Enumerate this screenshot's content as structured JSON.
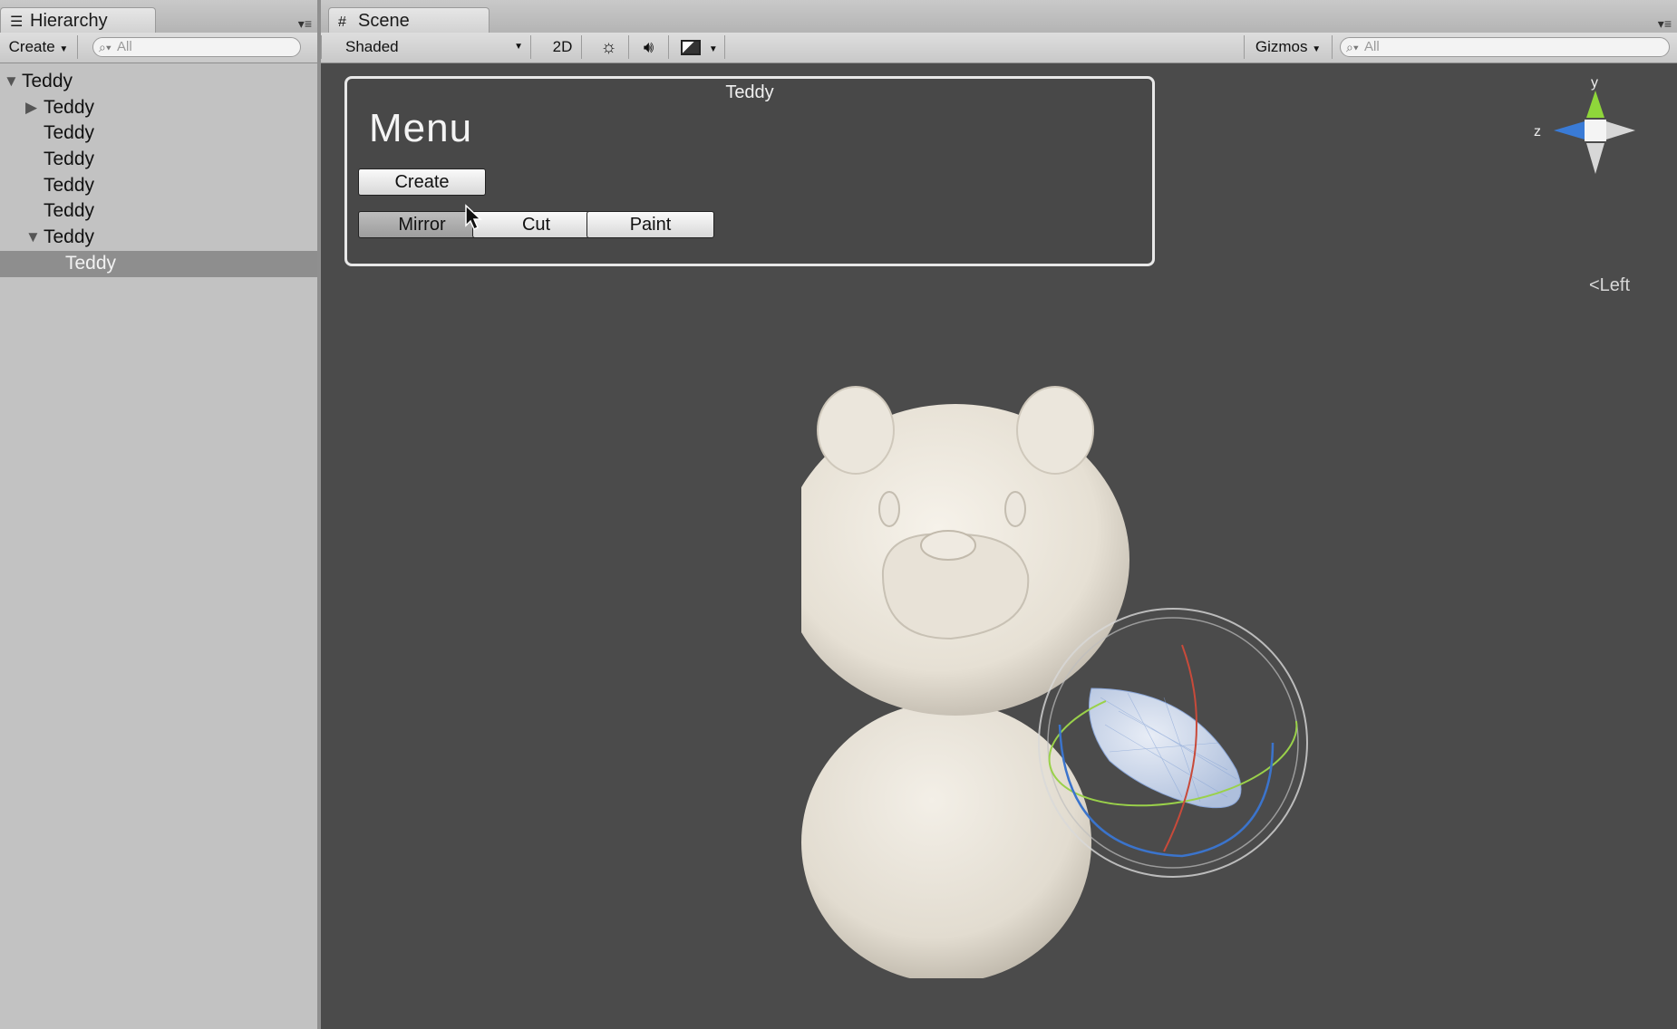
{
  "hierarchy": {
    "tab_label": "Hierarchy",
    "create_label": "Create",
    "search_placeholder": "All",
    "items": [
      {
        "label": "Teddy",
        "depth": 0,
        "expanded": true,
        "has_children": true
      },
      {
        "label": "Teddy",
        "depth": 1,
        "expanded": false,
        "has_children": true
      },
      {
        "label": "Teddy",
        "depth": 1,
        "has_children": false
      },
      {
        "label": "Teddy",
        "depth": 1,
        "has_children": false
      },
      {
        "label": "Teddy",
        "depth": 1,
        "has_children": false
      },
      {
        "label": "Teddy",
        "depth": 1,
        "has_children": false
      },
      {
        "label": "Teddy",
        "depth": 1,
        "expanded": true,
        "has_children": true
      },
      {
        "label": "Teddy",
        "depth": 2,
        "has_children": false,
        "selected": true
      }
    ]
  },
  "scene": {
    "tab_label": "Scene",
    "shading_mode": "Shaded",
    "mode_2d_label": "2D",
    "gizmos_label": "Gizmos",
    "search_placeholder": "All",
    "gui": {
      "window_title": "Teddy",
      "heading": "Menu",
      "buttons": {
        "create": "Create",
        "mirror": "Mirror",
        "cut": "Cut",
        "paint": "Paint"
      }
    },
    "orientation": {
      "view_label": "Left",
      "axis_y": "y",
      "axis_z": "z"
    }
  },
  "colors": {
    "viewport_bg": "#4b4b4b",
    "panel_bg": "#c2c2c2",
    "selection_bg": "#8e8e8e",
    "model_color": "#e8e3d8"
  },
  "icons": [
    "hierarchy-icon",
    "scene-grid-icon",
    "lighting-icon",
    "audio-icon",
    "effects-icon",
    "search-icon",
    "mouse-cursor-icon"
  ]
}
